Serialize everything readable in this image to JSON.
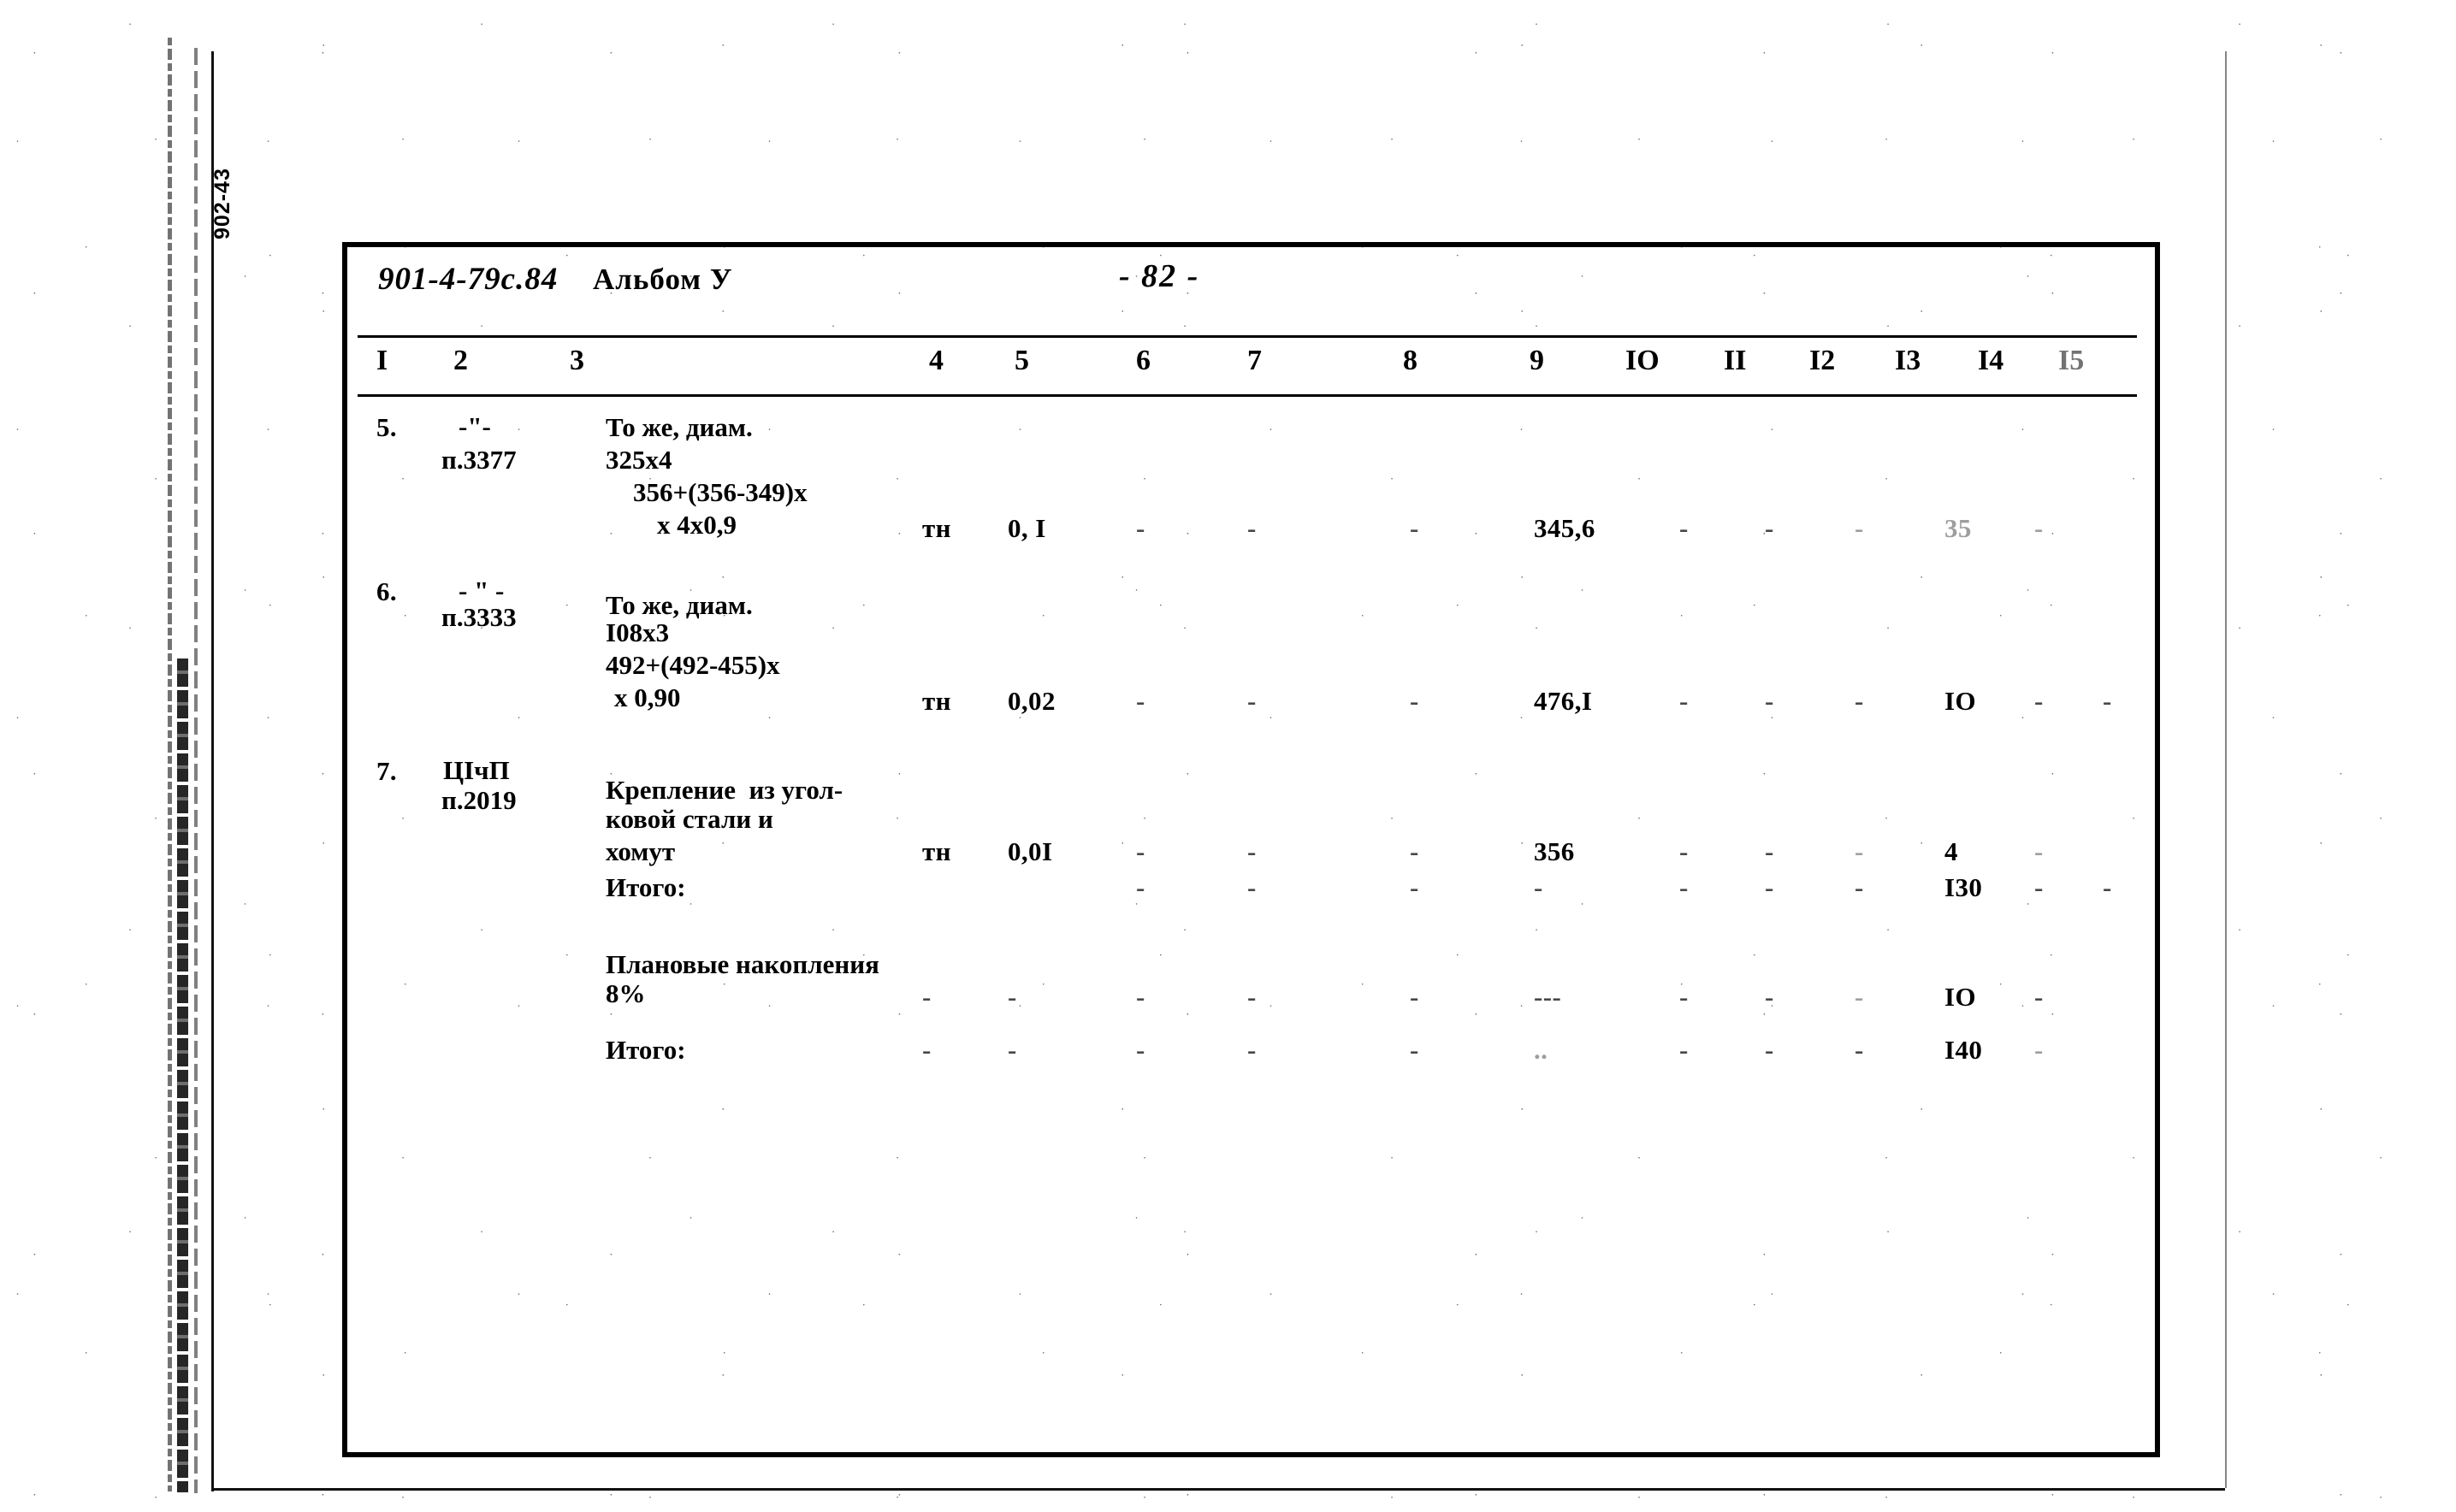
{
  "document": {
    "margin_code": "902-43",
    "code": "901-4-79с.84",
    "album": "Альбом У",
    "page_number": "- 82 -"
  },
  "table": {
    "column_headers": [
      "I",
      "2",
      "3",
      "4",
      "5",
      "6",
      "7",
      "8",
      "9",
      "IO",
      "II",
      "I2",
      "I3",
      "I4",
      "I5"
    ],
    "rows": [
      {
        "num": "5.",
        "ditto": "-\"-",
        "code": "п.3377",
        "desc_lines": [
          "То же, диам.",
          "325х4",
          "356+(356-349)х",
          "х 4х0,9"
        ],
        "unit": "тн",
        "qty": "0, I",
        "c6": "-",
        "c7": "-",
        "c8": "-",
        "c9": "345,6",
        "c10": "-",
        "c11": "-",
        "c12": "-",
        "c13": "35",
        "c14": "-",
        "c15": ""
      },
      {
        "num": "6.",
        "ditto": "- \" -",
        "code": "п.3333",
        "desc_lines": [
          "То же, диам.",
          "I08х3",
          "492+(492-455)х",
          "х 0,90"
        ],
        "unit": "тн",
        "qty": "0,02",
        "c6": "-",
        "c7": "-",
        "c8": "-",
        "c9": "476,I",
        "c10": "-",
        "c11": "-",
        "c12": "-",
        "c13": "IO",
        "c14": "-",
        "c15": "-"
      },
      {
        "num": "7.",
        "ditto": "ЦIчП",
        "code": "п.2019",
        "desc_lines": [
          "Крепление  из угол-",
          "ковой стали и",
          "хомут"
        ],
        "unit": "тн",
        "qty": "0,0I",
        "c6": "-",
        "c7": "-",
        "c8": "-",
        "c9": "356",
        "c10": "-",
        "c11": "-",
        "c12": "-",
        "c13": "4",
        "c14": "-",
        "c15": ""
      }
    ],
    "summary_rows": [
      {
        "label": "Итого:",
        "unit": "",
        "qty": "",
        "c6": "-",
        "c7": "-",
        "c8": "-",
        "c9": "-",
        "c10": "-",
        "c11": "-",
        "c12": "-",
        "c13": "I30",
        "c14": "-",
        "c15": "-"
      },
      {
        "label": "Плановые накопления",
        "label2": "8%",
        "unit": "-",
        "qty": "-",
        "c6": "-",
        "c7": "-",
        "c8": "-",
        "c9": "---",
        "c10": "-",
        "c11": "-",
        "c12": "-",
        "c13": "IO",
        "c14": "-",
        "c15": ""
      },
      {
        "label": "Итого:",
        "unit": "-",
        "qty": "-",
        "c6": "-",
        "c7": "-",
        "c8": "-",
        "c9": "..",
        "c10": "-",
        "c11": "-",
        "c12": "-",
        "c13": "I40",
        "c14": "-",
        "c15": ""
      }
    ]
  },
  "colors": {
    "ink": "#000000",
    "paper": "#ffffff"
  }
}
